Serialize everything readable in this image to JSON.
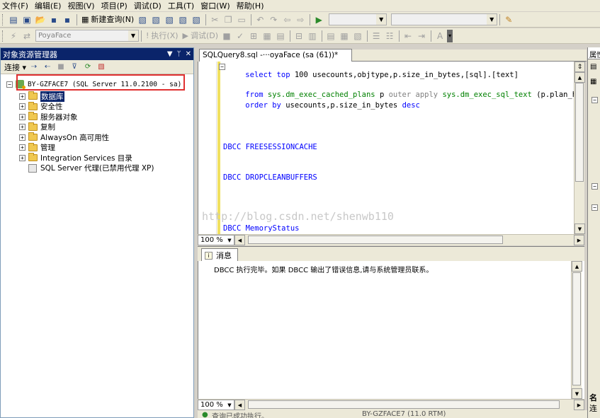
{
  "menu": [
    "文件(F)",
    "编辑(E)",
    "视图(V)",
    "项目(P)",
    "调试(D)",
    "工具(T)",
    "窗口(W)",
    "帮助(H)"
  ],
  "toolbar1": {
    "new_query": "新建查询(N)"
  },
  "toolbar2": {
    "database": "PoyaFace",
    "execute": "执行(X)",
    "debug": "调试(D)"
  },
  "object_explorer": {
    "title": "对象资源管理器",
    "pin": "▼ ᛘ ✕",
    "connect": "连接",
    "server": "BY-GZFACE7 (SQL Server 11.0.2100 - sa)",
    "nodes": [
      "数据库",
      "安全性",
      "服务器对象",
      "复制",
      "AlwaysOn 高可用性",
      "管理",
      "Integration Services 目录"
    ],
    "agent": "SQL Server 代理(已禁用代理 XP)"
  },
  "document_tab": "SQLQuery8.sql -···oyaFace (sa (61))*",
  "editor": {
    "lines": [
      {
        "kw1": "select top ",
        "num": "100",
        "rest": " usecounts,objtype,p.size_in_bytes,[sql].[text]"
      },
      {
        "kw1": "from ",
        "sys": "sys.dm_exec_cached_plans",
        "rest": " p ",
        "kw2": "outer apply ",
        "sys2": "sys.dm_exec_sql_text",
        "rest2": " (p.plan_handl"
      },
      {
        "kw1": "order by",
        "rest": " usecounts,p.size_in_bytes ",
        "kw2": "desc"
      }
    ],
    "dbcc1": "DBCC FREESESSIONCACHE",
    "dbcc2": "DBCC DROPCLEANBUFFERS",
    "dbcc3": "DBCC MemoryStatus",
    "zoom": "100 %"
  },
  "watermark": "http://blog.csdn.net/shenwb110",
  "results": {
    "tab": "消息",
    "message": "DBCC 执行完毕。如果 DBCC 输出了错误信息,请与系统管理员联系。",
    "zoom": "100 %"
  },
  "status": {
    "text": "查询已成功执行。",
    "server": "BY-GZFACE7 (11.0 RTM)"
  },
  "properties": {
    "title": "属性",
    "lower1": "名",
    "lower2": "连"
  }
}
